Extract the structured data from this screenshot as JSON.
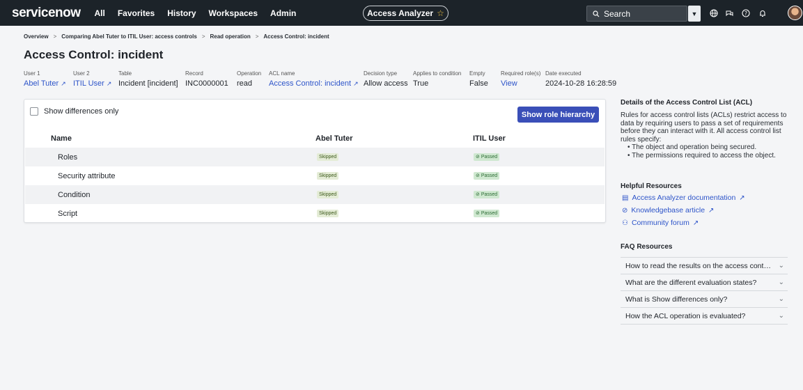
{
  "nav": {
    "logo": "servicenow",
    "items": [
      "All",
      "Favorites",
      "History",
      "Workspaces",
      "Admin"
    ],
    "app_pill": "Access Analyzer",
    "search_label": "Search"
  },
  "breadcrumb": [
    "Overview",
    "Comparing Abel Tuter to ITIL User: access controls",
    "Read operation",
    "Access Control: incident"
  ],
  "page_title": "Access Control: incident",
  "meta": [
    {
      "label": "User 1",
      "value": "Abel Tuter",
      "link": true
    },
    {
      "label": "User 2",
      "value": "ITIL User",
      "link": true
    },
    {
      "label": "Table",
      "value": "Incident [incident]",
      "link": false
    },
    {
      "label": "Record",
      "value": "INC0000001",
      "link": false
    },
    {
      "label": "Operation",
      "value": "read",
      "link": false
    },
    {
      "label": "ACL name",
      "value": "Access Control: incident",
      "link": true
    },
    {
      "label": "Decision type",
      "value": "Allow access",
      "link": false
    },
    {
      "label": "Applies to condition",
      "value": "True",
      "link": false
    },
    {
      "label": "Empty",
      "value": "False",
      "link": false
    },
    {
      "label": "Required role(s)",
      "value": "View",
      "link": true
    },
    {
      "label": "Date executed",
      "value": "2024-10-28 16:28:59",
      "link": false
    }
  ],
  "card": {
    "show_differences_label": "Show differences only",
    "role_hierarchy_button": "Show role hierarchy",
    "columns": [
      "Name",
      "Abel Tuter",
      "ITIL User"
    ],
    "rows": [
      {
        "name": "Roles",
        "user1": "Skipped",
        "user2": "Passed"
      },
      {
        "name": "Security attribute",
        "user1": "Skipped",
        "user2": "Passed"
      },
      {
        "name": "Condition",
        "user1": "Skipped",
        "user2": "Passed"
      },
      {
        "name": "Script",
        "user1": "Skipped",
        "user2": "Passed"
      }
    ]
  },
  "right_panel": {
    "details_title": "Details of the Access Control List (ACL)",
    "details_text": "Rules for access control lists (ACLs) restrict access to data by requiring users to pass a set of requirements before they can interact with it. All access control list rules specify:",
    "details_bullets": [
      "The object and operation being secured.",
      "The permissions required to access the object."
    ],
    "helpful_title": "Helpful Resources",
    "resources": [
      "Access Analyzer documentation",
      "Knowledgebase article",
      "Community forum"
    ],
    "faq_title": "FAQ Resources",
    "faqs": [
      "How to read the results on the access cont…",
      "What are the different evaluation states?",
      "What is Show differences only?",
      "How the ACL operation is evaluated?"
    ]
  },
  "colors": {
    "nav_bg": "#1c2329",
    "accent": "#3a4fb8",
    "link": "#2d54c9"
  }
}
